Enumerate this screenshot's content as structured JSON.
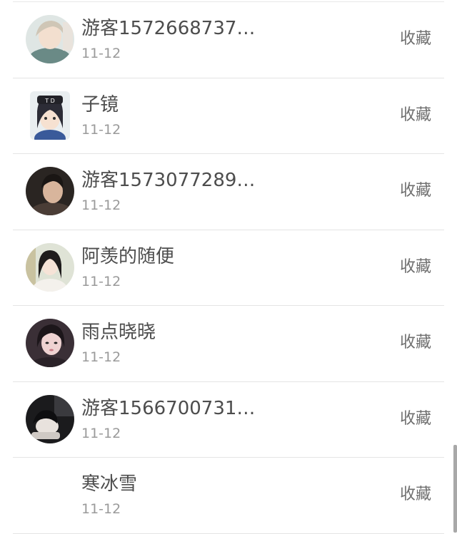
{
  "list": {
    "items": [
      {
        "name": "游客1572668737…",
        "date": "11-12",
        "action": "收藏",
        "avatar": "avatar-1"
      },
      {
        "name": "子镜",
        "date": "11-12",
        "action": "收藏",
        "avatar": "avatar-2"
      },
      {
        "name": "游客1573077289…",
        "date": "11-12",
        "action": "收藏",
        "avatar": "avatar-3"
      },
      {
        "name": "阿羡的随便",
        "date": "11-12",
        "action": "收藏",
        "avatar": "avatar-4"
      },
      {
        "name": "雨点晓晓",
        "date": "11-12",
        "action": "收藏",
        "avatar": "avatar-5"
      },
      {
        "name": "游客1566700731…",
        "date": "11-12",
        "action": "收藏",
        "avatar": "avatar-6"
      },
      {
        "name": "寒冰雪",
        "date": "11-12",
        "action": "收藏",
        "avatar": "none"
      }
    ]
  },
  "colors": {
    "name_text": "#4d4d4d",
    "date_text": "#9a9a9a",
    "action_text": "#6f6f6f",
    "divider": "#e4e4e4",
    "scrollbar": "#a8a8a8"
  }
}
